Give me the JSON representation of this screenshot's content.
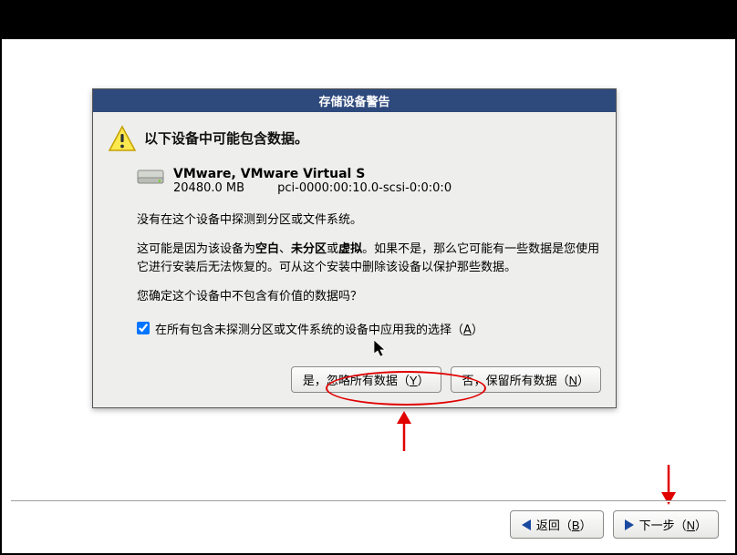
{
  "dialog": {
    "title": "存储设备警告",
    "warning_heading": "以下设备中可能包含数据。",
    "device": {
      "name": "VMware, VMware Virtual S",
      "size": "20480.0 MB",
      "path": "pci-0000:00:10.0-scsi-0:0:0:0"
    },
    "paragraph1": "没有在这个设备中探测到分区或文件系统。",
    "paragraph2_a": "这可能是因为该设备为",
    "paragraph2_blank": "空白",
    "paragraph2_sep1": "、",
    "paragraph2_unpart": "未分区",
    "paragraph2_sep2": "或",
    "paragraph2_virtual": "虚拟",
    "paragraph2_b": "。如果不是，那么它可能有一些数据是您使用它进行安装后无法恢复的。可从这个安装中删除该设备以保护那些数据。",
    "paragraph3": "您确定这个设备中不包含有价值的数据吗？",
    "checkbox_label_a": "在所有包含未探测分区或文件系统的设备中应用我的选择（",
    "checkbox_mn": "A",
    "checkbox_label_b": "）",
    "checkbox_checked": true,
    "btn_yes_a": "是，忽略所有数据（",
    "btn_yes_mn": "Y",
    "btn_yes_b": "）",
    "btn_no_a": "否，保留所有数据（",
    "btn_no_mn": "N",
    "btn_no_b": "）"
  },
  "nav": {
    "back_a": "返回（",
    "back_mn": "B",
    "back_b": "）",
    "next_a": "下一步（",
    "next_mn": "N",
    "next_b": "）"
  }
}
